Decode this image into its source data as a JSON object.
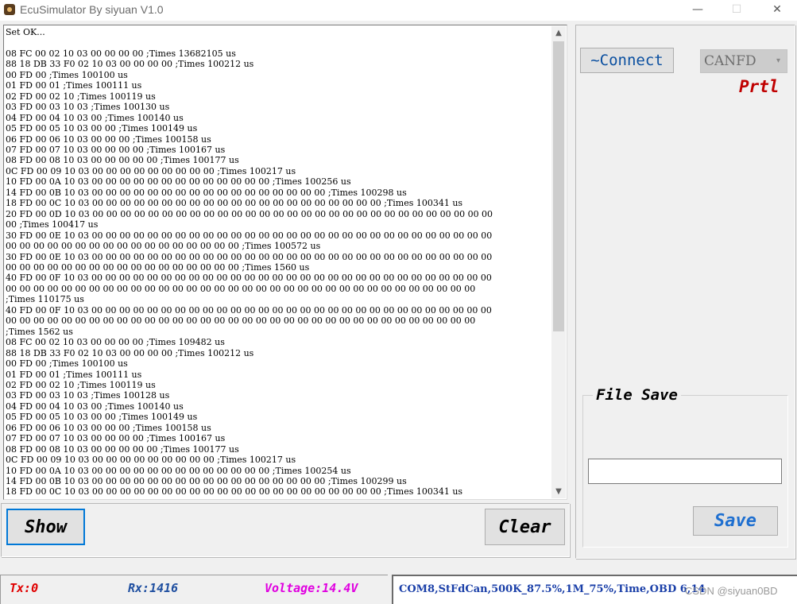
{
  "window": {
    "title": "EcuSimulator By siyuan V1.0",
    "minimize": "—",
    "maximize": "☐",
    "close": "✕"
  },
  "log": {
    "lines": [
      "Set OK...",
      "",
      "08 FC 00 02 10 03 00 00 00 00 ;Times 13682105 us",
      "88 18 DB 33 F0 02 10 03 00 00 00 00 ;Times 100212 us",
      "00 FD 00 ;Times 100100 us",
      "01 FD 00 01 ;Times 100111 us",
      "02 FD 00 02 10 ;Times 100119 us",
      "03 FD 00 03 10 03 ;Times 100130 us",
      "04 FD 00 04 10 03 00 ;Times 100140 us",
      "05 FD 00 05 10 03 00 00 ;Times 100149 us",
      "06 FD 00 06 10 03 00 00 00 ;Times 100158 us",
      "07 FD 00 07 10 03 00 00 00 00 ;Times 100167 us",
      "08 FD 00 08 10 03 00 00 00 00 00 ;Times 100177 us",
      "0C FD 00 09 10 03 00 00 00 00 00 00 00 00 00 ;Times 100217 us",
      "10 FD 00 0A 10 03 00 00 00 00 00 00 00 00 00 00 00 00 00 ;Times 100256 us",
      "14 FD 00 0B 10 03 00 00 00 00 00 00 00 00 00 00 00 00 00 00 00 00 00 ;Times 100298 us",
      "18 FD 00 0C 10 03 00 00 00 00 00 00 00 00 00 00 00 00 00 00 00 00 00 00 00 00 00 ;Times 100341 us",
      "20 FD 00 0D 10 03 00 00 00 00 00 00 00 00 00 00 00 00 00 00 00 00 00 00 00 00 00 00 00 00 00 00 00 00 00",
      "00 ;Times 100417 us",
      "30 FD 00 0E 10 03 00 00 00 00 00 00 00 00 00 00 00 00 00 00 00 00 00 00 00 00 00 00 00 00 00 00 00 00 00",
      "00 00 00 00 00 00 00 00 00 00 00 00 00 00 00 00 00 ;Times 100572 us",
      "30 FD 00 0E 10 03 00 00 00 00 00 00 00 00 00 00 00 00 00 00 00 00 00 00 00 00 00 00 00 00 00 00 00 00 00",
      "00 00 00 00 00 00 00 00 00 00 00 00 00 00 00 00 00 ;Times 1560 us",
      "40 FD 00 0F 10 03 00 00 00 00 00 00 00 00 00 00 00 00 00 00 00 00 00 00 00 00 00 00 00 00 00 00 00 00 00",
      "00 00 00 00 00 00 00 00 00 00 00 00 00 00 00 00 00 00 00 00 00 00 00 00 00 00 00 00 00 00 00 00 00 00",
      ";Times 110175 us",
      "40 FD 00 0F 10 03 00 00 00 00 00 00 00 00 00 00 00 00 00 00 00 00 00 00 00 00 00 00 00 00 00 00 00 00 00",
      "00 00 00 00 00 00 00 00 00 00 00 00 00 00 00 00 00 00 00 00 00 00 00 00 00 00 00 00 00 00 00 00 00 00",
      ";Times 1562 us",
      "08 FC 00 02 10 03 00 00 00 00 ;Times 109482 us",
      "88 18 DB 33 F0 02 10 03 00 00 00 00 ;Times 100212 us",
      "00 FD 00 ;Times 100100 us",
      "01 FD 00 01 ;Times 100111 us",
      "02 FD 00 02 10 ;Times 100119 us",
      "03 FD 00 03 10 03 ;Times 100128 us",
      "04 FD 00 04 10 03 00 ;Times 100140 us",
      "05 FD 00 05 10 03 00 00 ;Times 100149 us",
      "06 FD 00 06 10 03 00 00 00 ;Times 100158 us",
      "07 FD 00 07 10 03 00 00 00 00 ;Times 100167 us",
      "08 FD 00 08 10 03 00 00 00 00 00 ;Times 100177 us",
      "0C FD 00 09 10 03 00 00 00 00 00 00 00 00 00 ;Times 100217 us",
      "10 FD 00 0A 10 03 00 00 00 00 00 00 00 00 00 00 00 00 00 ;Times 100254 us",
      "14 FD 00 0B 10 03 00 00 00 00 00 00 00 00 00 00 00 00 00 00 00 00 00 ;Times 100299 us",
      "18 FD 00 0C 10 03 00 00 00 00 00 00 00 00 00 00 00 00 00 00 00 00 00 00 00 00 00 ;Times 100341 us"
    ]
  },
  "buttons": {
    "show": "Show",
    "clear": "Clear",
    "connect": "~Connect",
    "save": "Save"
  },
  "protocol": {
    "selected": "CANFD",
    "label": "Prtl"
  },
  "file_save": {
    "legend": "File Save",
    "path_value": ""
  },
  "status": {
    "tx": "Tx:0",
    "rx": "Rx:1416",
    "voltage": "Voltage:14.4V",
    "info": "COM8,StFdCan,500K_87.5%,1M_75%,Time,OBD 6,14",
    "watermark": "CSDN @siyuan0BD"
  },
  "icons": {
    "scroll_up": "▲",
    "scroll_down": "▼",
    "chevron": "▾"
  }
}
